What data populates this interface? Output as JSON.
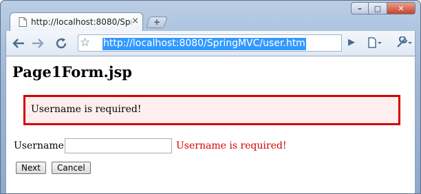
{
  "browser": {
    "tab": {
      "title": "http://localhost:8080/Spr...",
      "close_glyph": "×"
    },
    "new_tab_glyph": "+",
    "window_buttons": {
      "minimize": "–",
      "maximize": "□",
      "close": "✕"
    },
    "toolbar": {
      "back_icon": "back-arrow-icon",
      "forward_icon": "forward-arrow-icon",
      "reload_icon": "reload-icon",
      "bookmark_icon": "star-icon",
      "url": "http://localhost:8080/SpringMVC/user.htm",
      "go_icon": "play-icon",
      "page_menu_icon": "page-menu-icon",
      "wrench_icon": "wrench-icon"
    }
  },
  "page": {
    "title": "Page1Form.jsp",
    "error_summary": "Username is required!",
    "form": {
      "username_label": "Username :",
      "username_value": "",
      "username_error": "Username is required!",
      "next_label": "Next",
      "cancel_label": "Cancel"
    }
  },
  "colors": {
    "error_text": "#d40000",
    "error_border": "#d40000",
    "error_background": "#ffeeee",
    "url_selection": "#3399ff"
  }
}
